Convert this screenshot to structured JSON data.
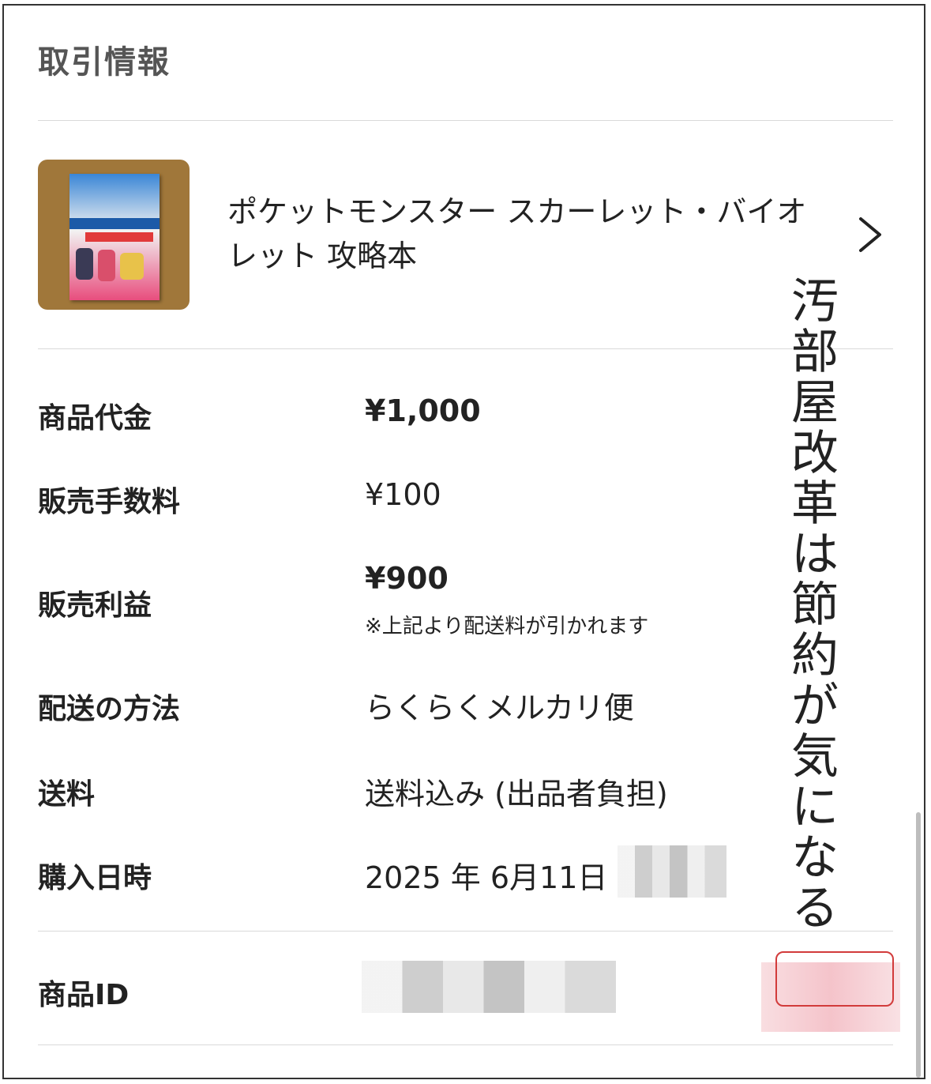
{
  "section": {
    "title": "取引情報"
  },
  "product": {
    "title": "ポケットモンスター スカーレット・バイオレット 攻略本",
    "thumbnail_icon": "book-cover-image",
    "chevron_icon": "chevron-right-icon"
  },
  "rows": [
    {
      "label": "商品代金",
      "value": "¥1,000"
    },
    {
      "label": "販売手数料",
      "value": "¥100"
    },
    {
      "label": "販売利益",
      "value": "¥900",
      "note": "※上記より配送料が引かれます"
    },
    {
      "label": "配送の方法",
      "value": "らくらくメルカリ便"
    },
    {
      "label": "送料",
      "value": "送料込み (出品者負担)"
    },
    {
      "label": "購入日時",
      "value": "2025 年 6月11日"
    },
    {
      "label": "商品ID",
      "value": ""
    }
  ],
  "overlay": {
    "handwritten": "汚部屋改革は節約が気になる"
  },
  "colors": {
    "divider": "#d9d9d9",
    "copy_button_border": "#d23b3b"
  }
}
